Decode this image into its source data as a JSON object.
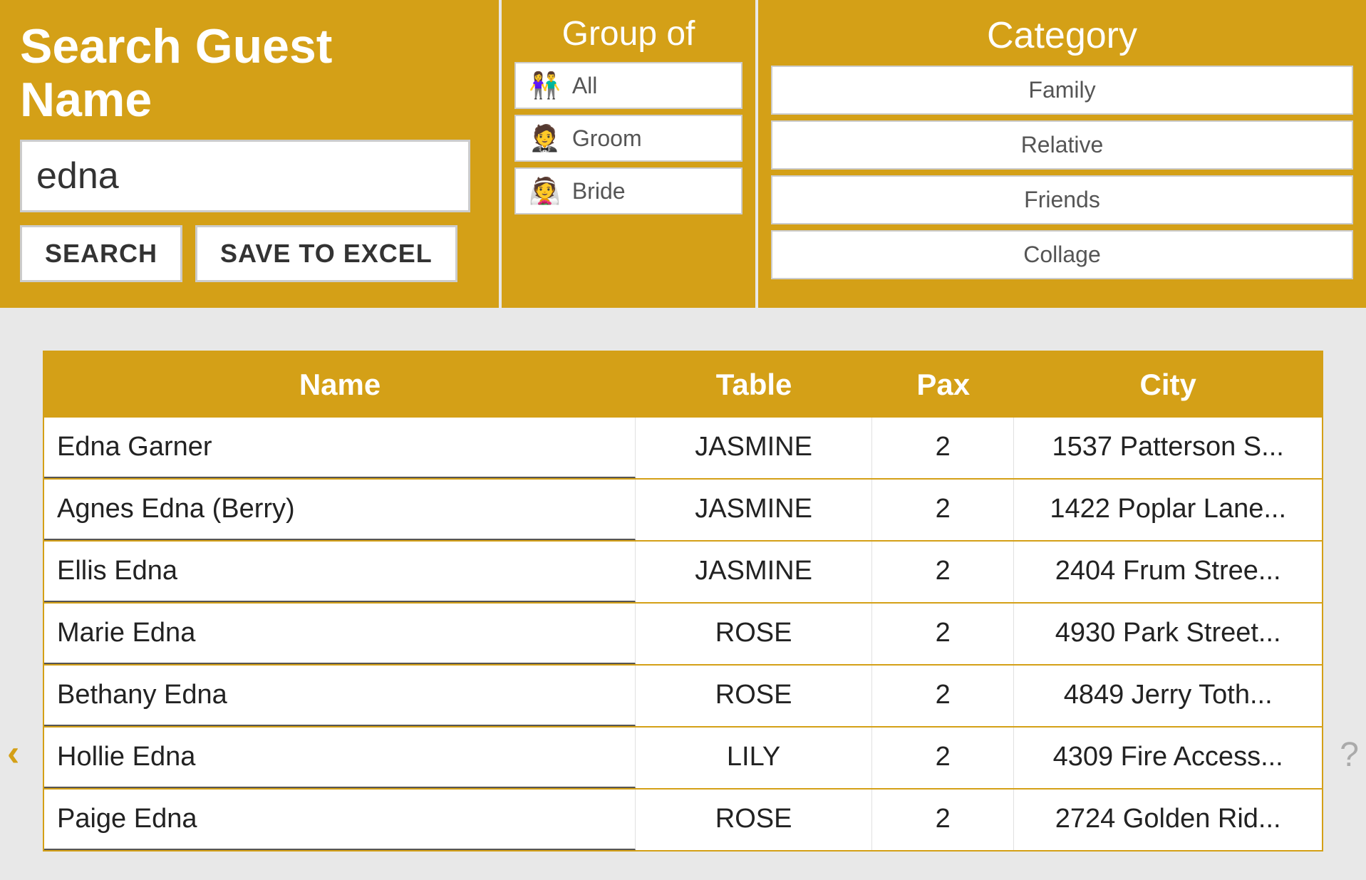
{
  "header": {
    "search_title": "Search Guest Name",
    "search_value": "edna",
    "search_placeholder": "edna",
    "search_label": "SEARCH",
    "excel_label": "SAVE TO EXCEL"
  },
  "group_of": {
    "title": "Group of",
    "buttons": [
      {
        "label": "All",
        "icon": "👫"
      },
      {
        "label": "Groom",
        "icon": "🤵"
      },
      {
        "label": "Bride",
        "icon": "👰"
      }
    ]
  },
  "category": {
    "title": "Category",
    "buttons": [
      {
        "label": "Family"
      },
      {
        "label": "Relative"
      },
      {
        "label": "Friends"
      },
      {
        "label": "Collage"
      }
    ]
  },
  "table": {
    "columns": [
      "Name",
      "Table",
      "Pax",
      "City"
    ],
    "rows": [
      {
        "name": "Edna Garner",
        "table": "JASMINE",
        "pax": "2",
        "city": "1537 Patterson S..."
      },
      {
        "name": "Agnes Edna (Berry)",
        "table": "JASMINE",
        "pax": "2",
        "city": "1422 Poplar Lane..."
      },
      {
        "name": "Ellis Edna",
        "table": "JASMINE",
        "pax": "2",
        "city": "2404 Frum Stree..."
      },
      {
        "name": "Marie Edna",
        "table": "ROSE",
        "pax": "2",
        "city": "4930 Park Street..."
      },
      {
        "name": "Bethany Edna",
        "table": "ROSE",
        "pax": "2",
        "city": "4849 Jerry Toth..."
      },
      {
        "name": "Hollie Edna",
        "table": "LILY",
        "pax": "2",
        "city": "4309 Fire Access..."
      },
      {
        "name": "Paige Edna",
        "table": "ROSE",
        "pax": "2",
        "city": "2724 Golden Rid..."
      }
    ]
  },
  "nav": {
    "left": "‹",
    "right": "?"
  }
}
